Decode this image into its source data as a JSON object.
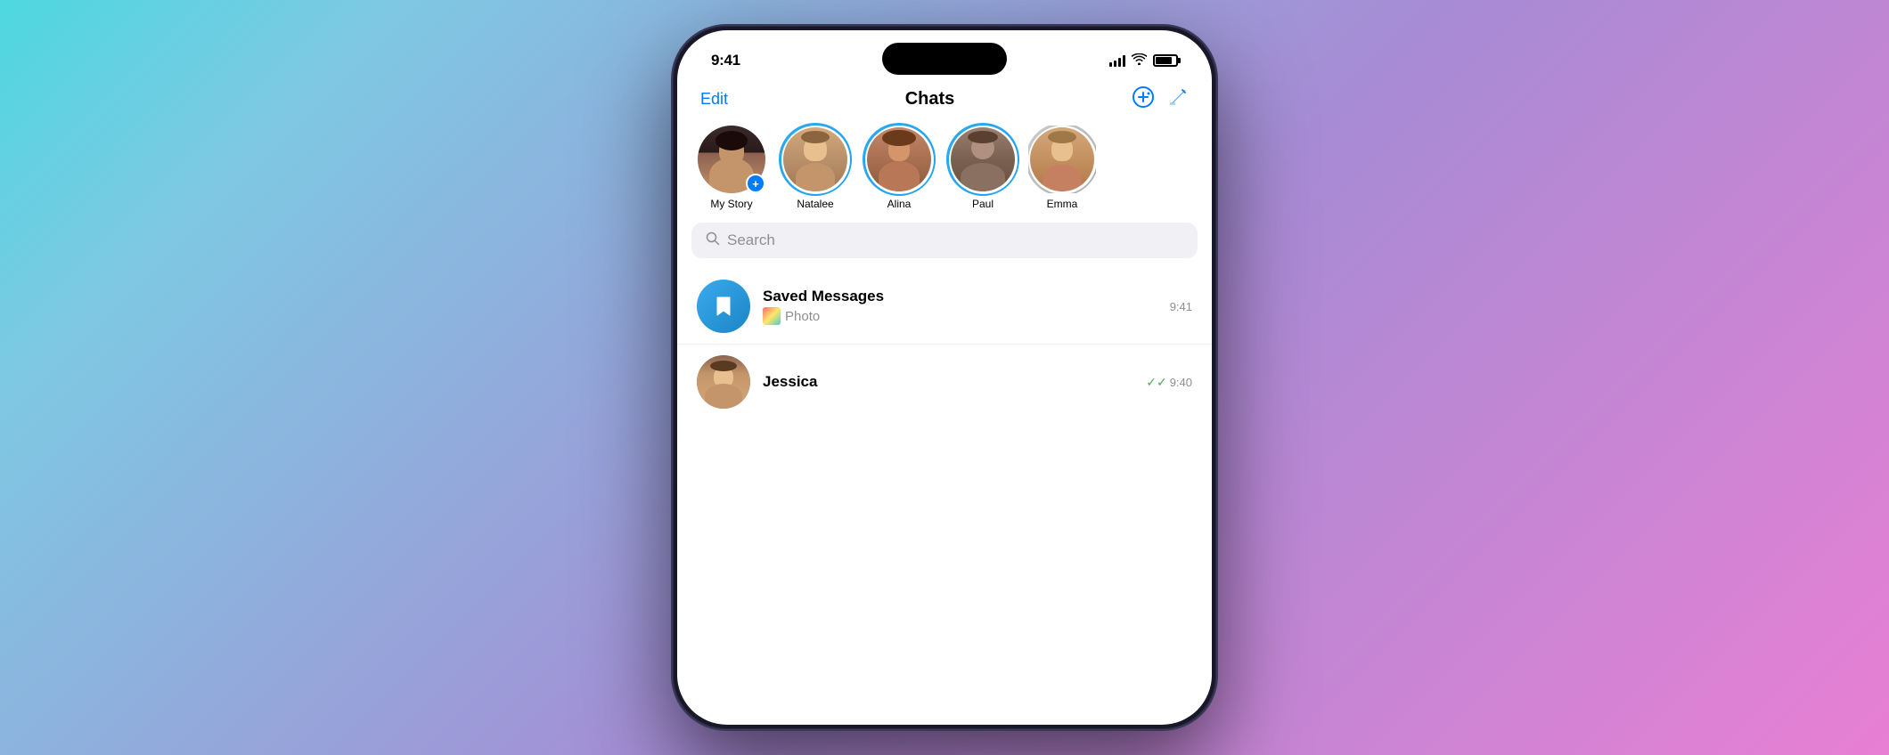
{
  "background": {
    "gradient_start": "#4dd8e0",
    "gradient_end": "#e87fd4"
  },
  "status_bar": {
    "time": "9:41",
    "signal_label": "signal",
    "wifi_label": "wifi",
    "battery_label": "battery"
  },
  "header": {
    "edit_label": "Edit",
    "title": "Chats",
    "new_group_icon": "new-group-icon",
    "compose_icon": "compose-icon"
  },
  "stories": [
    {
      "id": "my-story",
      "label": "My Story",
      "is_self": true
    },
    {
      "id": "natalee",
      "label": "Natalee",
      "has_ring": true
    },
    {
      "id": "alina",
      "label": "Alina",
      "has_ring": true
    },
    {
      "id": "paul",
      "label": "Paul",
      "has_ring": true
    },
    {
      "id": "emma",
      "label": "Emma",
      "has_ring": true,
      "partial": true
    }
  ],
  "search": {
    "placeholder": "Search"
  },
  "chats": [
    {
      "id": "saved-messages",
      "name": "Saved Messages",
      "preview": "Photo",
      "time": "9:41",
      "type": "saved",
      "has_photo_thumbnail": true
    },
    {
      "id": "jessica",
      "name": "Jessica",
      "preview": "",
      "time": "9:40",
      "type": "contact",
      "has_double_check": true,
      "partial": true
    }
  ]
}
